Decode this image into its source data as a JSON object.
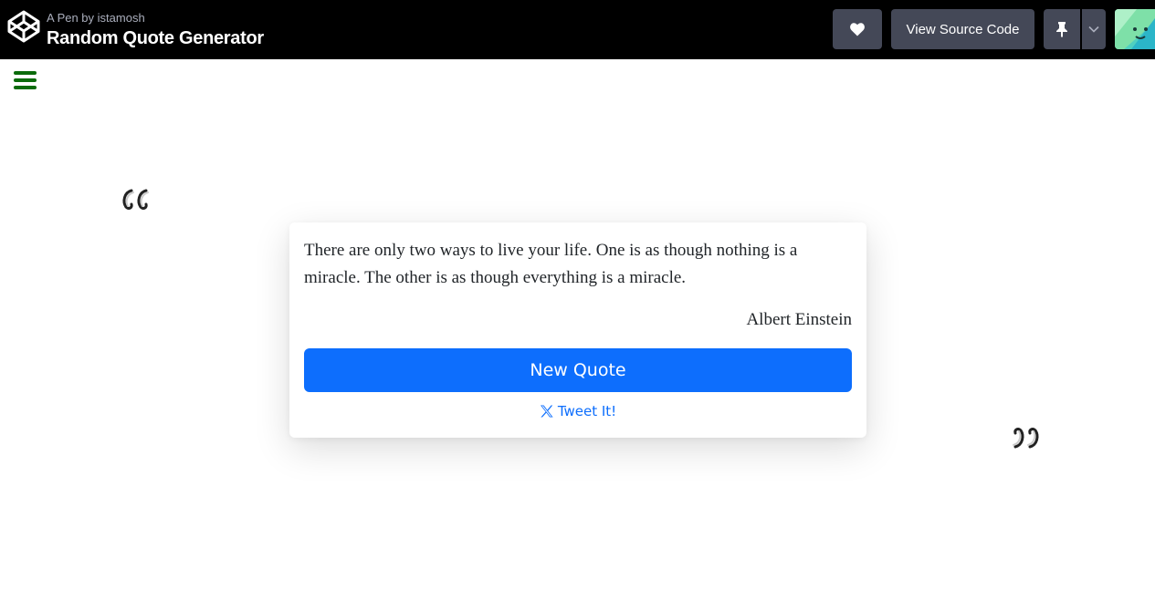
{
  "header": {
    "pen_meta": "A Pen by istamosh",
    "title": "Random Quote Generator",
    "view_source_label": "View Source Code"
  },
  "icons": {
    "logo": "codepen-logo-icon",
    "like": "heart-icon",
    "pin": "pin-icon",
    "dropdown": "chevron-down-icon",
    "menu": "hamburger-menu-icon",
    "open_quote": "open-quote-icon",
    "close_quote": "close-quote-icon",
    "tweet": "x-logo-icon"
  },
  "quote": {
    "text": "There are only two ways to live your life. One is as though nothing is a miracle. The other is as though everything is a miracle.",
    "author": "Albert Einstein"
  },
  "actions": {
    "new_quote_label": "New Quote",
    "tweet_label": "Tweet It!"
  },
  "colors": {
    "topbar": "#000000",
    "dark_button": "#444857",
    "primary": "#0d6efd",
    "menu_icon": "#0b6b0b"
  }
}
